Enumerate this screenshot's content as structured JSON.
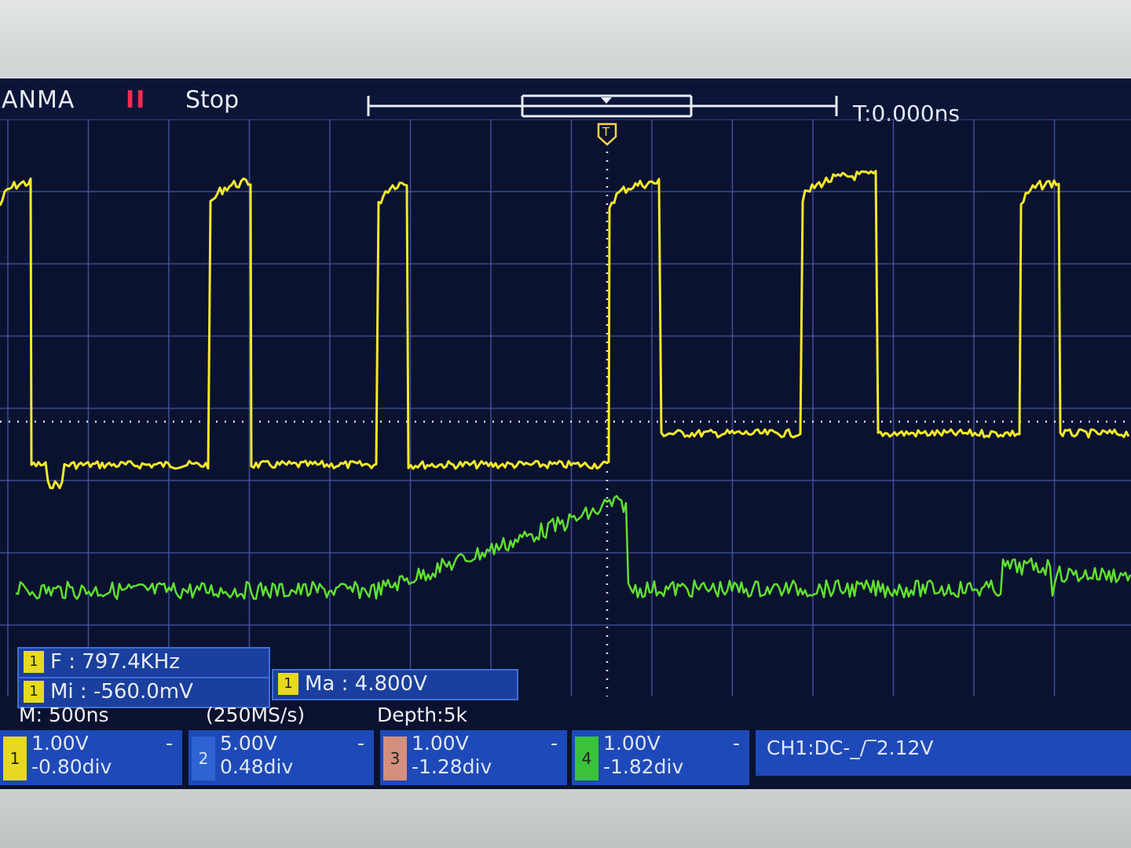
{
  "header": {
    "brand": "ANMA",
    "run_indicator": "II",
    "run_state": "Stop",
    "time_offset": "T:0.000ns",
    "trigger_marker_icon": "T"
  },
  "measurements": {
    "frequency": {
      "channel": "1",
      "label": "F : 797.4KHz"
    },
    "minimum": {
      "channel": "1",
      "label": "Mi : -560.0mV"
    },
    "maximum": {
      "channel": "1",
      "label": "Ma : 4.800V"
    }
  },
  "acquisition": {
    "timebase": "M: 500ns",
    "sample_rate": "(250MS/s)",
    "depth": "Depth:5k"
  },
  "channels": [
    {
      "number": "1",
      "scale": "1.00V",
      "offset": "-0.80div",
      "marker": "-",
      "color": "#e6d920"
    },
    {
      "number": "2",
      "scale": "5.00V",
      "offset": "0.48div",
      "marker": "-",
      "color": "#2f63d4"
    },
    {
      "number": "3",
      "scale": "1.00V",
      "offset": "-1.28div",
      "marker": "-",
      "color": "#d48f7c"
    },
    {
      "number": "4",
      "scale": "1.00V",
      "offset": "-1.82div",
      "marker": "-",
      "color": "#39c23a"
    }
  ],
  "trigger": {
    "label": "CH1:DC-_/‾2.12V"
  },
  "colors": {
    "ch1_trace": "#f2ea2a",
    "ch4_trace": "#5fe02e",
    "grid": "#4a5aa8",
    "screen_bg": "#0b1230"
  }
}
